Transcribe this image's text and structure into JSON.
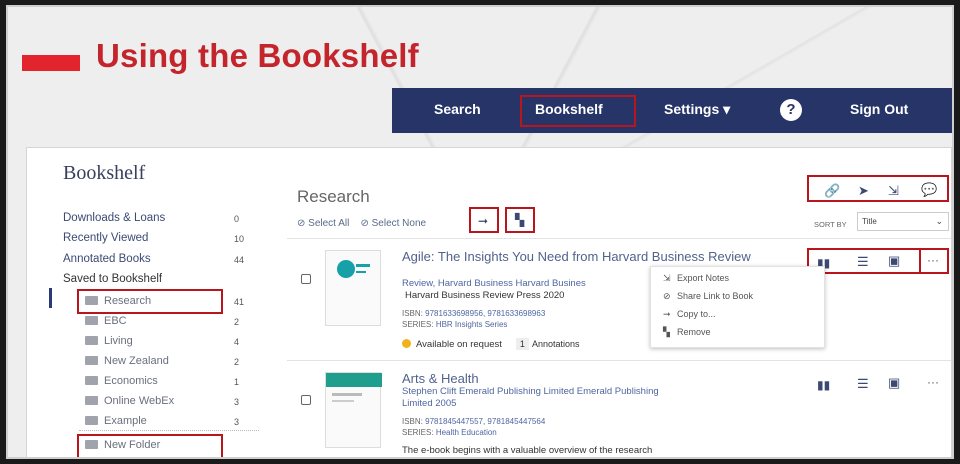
{
  "slide": {
    "title": "Using the Bookshelf"
  },
  "nav": {
    "search": "Search",
    "bookshelf": "Bookshelf",
    "settings": "Settings",
    "settings_caret": "▾",
    "help": "?",
    "sign_out": "Sign Out"
  },
  "sidebar": {
    "heading": "Bookshelf",
    "items": [
      {
        "label": "Downloads & Loans",
        "count": "0"
      },
      {
        "label": "Recently Viewed",
        "count": "10"
      },
      {
        "label": "Annotated Books",
        "count": "44"
      },
      {
        "label": "Saved to Bookshelf",
        "count": ""
      }
    ],
    "folders": [
      {
        "label": "Research",
        "count": "41"
      },
      {
        "label": "EBC",
        "count": "2"
      },
      {
        "label": "Living",
        "count": "4"
      },
      {
        "label": "New Zealand",
        "count": "2"
      },
      {
        "label": "Economics",
        "count": "1"
      },
      {
        "label": "Online WebEx",
        "count": "3"
      },
      {
        "label": "Example",
        "count": "3"
      }
    ],
    "new_folder": "New Folder"
  },
  "main": {
    "heading": "Research",
    "select_all": "Select All",
    "select_none": "Select None",
    "sort_by_label": "SORT BY",
    "sort_value": "Title",
    "sort_caret": "⌄",
    "top_icons": {
      "link": "🔗",
      "send": "➤",
      "export": "⇲",
      "comment": "💬"
    }
  },
  "books": [
    {
      "title": "Agile: The Insights You Need from Harvard Business Review",
      "authors": "Review, Harvard Business  Harvard Busines",
      "publisher": "Harvard Business Review Press  2020",
      "isbn_label": "ISBN:",
      "isbn": "9781633698956, 9781633698963",
      "series_label": "SERIES:",
      "series": "HBR Insights Series",
      "availability": "Available on request",
      "annotations_count": "1",
      "annotations_label": "Annotations"
    },
    {
      "title": "Arts & Health",
      "authors": "Stephen Clift  Emerald Publishing Limited  Emerald Publishing",
      "publisher": "Limited  2005",
      "isbn_label": "ISBN:",
      "isbn": "9781845447557, 9781845447564",
      "series_label": "SERIES:",
      "series": "Health Education",
      "description": "The e-book begins with a valuable overview of the research"
    }
  ],
  "context_menu": {
    "items": [
      {
        "label": "Export Notes"
      },
      {
        "label": "Share Link to Book"
      },
      {
        "label": "Copy to..."
      },
      {
        "label": "Remove"
      }
    ]
  },
  "colors": {
    "accent_red": "#c4242b",
    "nav_bg": "#263468",
    "highlight": "#b8151c",
    "link_blue": "#4e66a0",
    "availability_dot": "#f2b21d"
  }
}
